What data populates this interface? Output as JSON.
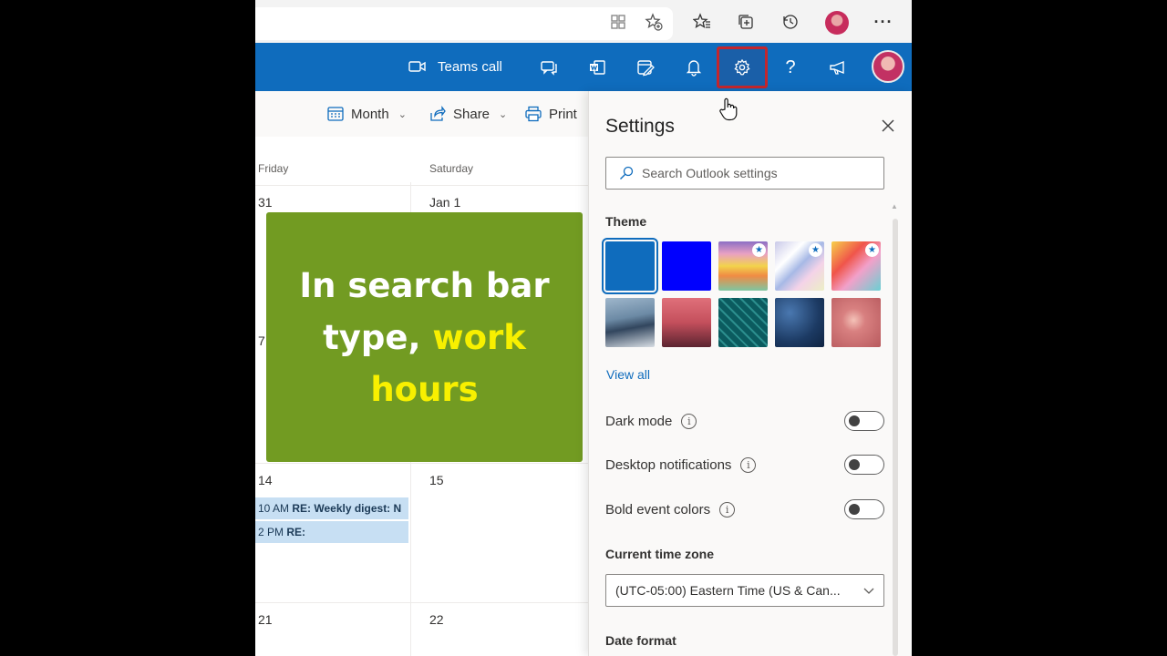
{
  "browser": {
    "icons": [
      "split-screen-icon",
      "add-favorite-icon",
      "favorites-icon",
      "collections-icon",
      "history-icon",
      "profile-avatar",
      "more-icon"
    ]
  },
  "header": {
    "teams_call_label": "Teams call",
    "icons": [
      "chat-icon",
      "word-icon",
      "my-day-icon",
      "notifications-icon",
      "settings-icon",
      "help-icon",
      "feedback-icon"
    ],
    "settings_highlight_color": "#c3262d",
    "accent": "#0f6cbd"
  },
  "calendar": {
    "toolbar": {
      "view_label": "Month",
      "share_label": "Share",
      "print_label": "Print"
    },
    "day_names": [
      "Friday",
      "Saturday"
    ],
    "week_rows": [
      {
        "friday": "31",
        "saturday": "Jan 1"
      },
      {
        "friday": "7",
        "saturday": ""
      },
      {
        "friday": "14",
        "saturday": "15"
      },
      {
        "friday": "21",
        "saturday": "22"
      }
    ],
    "events": [
      {
        "time": "10 AM",
        "title": "RE: Weekly digest: N"
      },
      {
        "time": "2 PM",
        "title": "RE:"
      }
    ]
  },
  "overlay": {
    "line1": "In search bar",
    "line2_white": "type, ",
    "line2_yellow": "work",
    "line3_yellow": "hours",
    "bg_color": "#729b22",
    "highlight_color": "#f8f000"
  },
  "settings": {
    "title": "Settings",
    "search_placeholder": "Search Outlook settings",
    "theme_label": "Theme",
    "view_all_label": "View all",
    "toggles": [
      {
        "label": "Dark mode",
        "on": false
      },
      {
        "label": "Desktop notifications",
        "on": false
      },
      {
        "label": "Bold event colors",
        "on": false
      }
    ],
    "time_zone_label": "Current time zone",
    "time_zone_value": "(UTC-05:00) Eastern Time (US & Can...",
    "date_format_label": "Date format"
  }
}
